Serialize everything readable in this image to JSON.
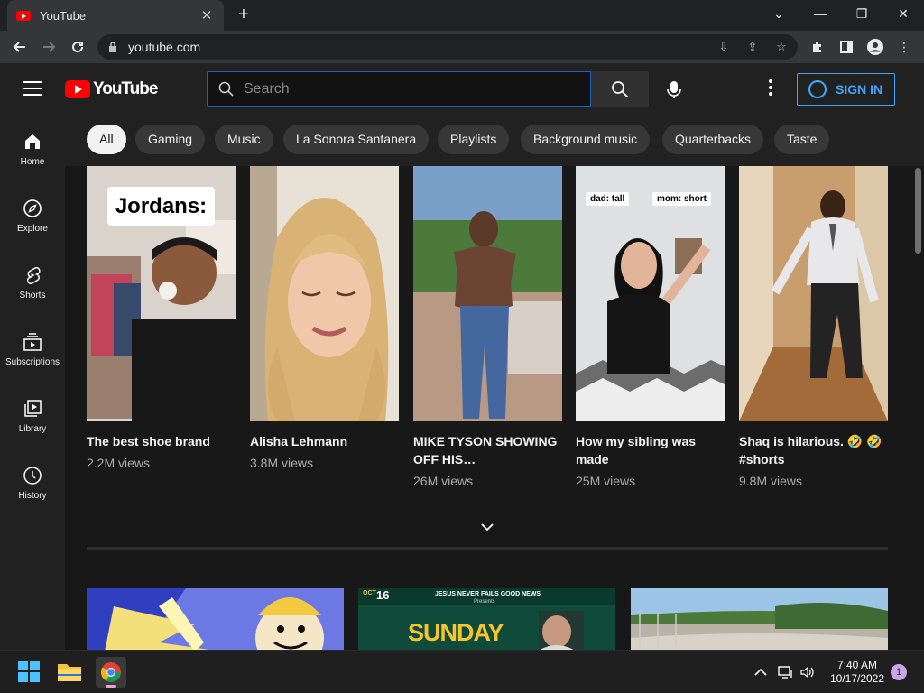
{
  "browser": {
    "tab_title": "YouTube",
    "tab_close": "✕",
    "new_tab": "+",
    "url": "youtube.com",
    "window_controls": [
      "⌄",
      "—",
      "❐",
      "✕"
    ]
  },
  "header": {
    "logo_text": "YouTube",
    "search_placeholder": "Search",
    "sign_in": "SIGN IN"
  },
  "chips": [
    "All",
    "Gaming",
    "Music",
    "La Sonora Santanera",
    "Playlists",
    "Background music",
    "Quarterbacks",
    "Taste"
  ],
  "sidebar": {
    "items": [
      {
        "label": "Home",
        "icon": "home-icon"
      },
      {
        "label": "Explore",
        "icon": "compass-icon"
      },
      {
        "label": "Shorts",
        "icon": "shorts-icon"
      },
      {
        "label": "Subscriptions",
        "icon": "subscriptions-icon"
      },
      {
        "label": "Library",
        "icon": "library-icon"
      },
      {
        "label": "History",
        "icon": "history-icon"
      }
    ]
  },
  "shorts": [
    {
      "title": "The best shoe brand",
      "views": "2.2M views",
      "overlay": "Jordans:"
    },
    {
      "title": "Alisha Lehmann",
      "views": "3.8M views"
    },
    {
      "title": "MIKE TYSON SHOWING OFF HIS…",
      "views": "26M views"
    },
    {
      "title": "How my sibling was made",
      "views": "25M views",
      "overlay_left": "dad: tall",
      "overlay_right": "mom: short"
    },
    {
      "title": "Shaq is hilarious. 🤣 🤣 #shorts",
      "views": "9.8M views"
    }
  ],
  "bottom_videos": [
    {
      "overlay": ""
    },
    {
      "date_day": "16",
      "date_month": "OCT",
      "banner": "JESUS NEVER FAILS GOOD NEWS",
      "sub": "Presents",
      "title": "SUNDAY"
    },
    {
      "overlay": ""
    }
  ],
  "taskbar": {
    "time": "7:40 AM",
    "date": "10/17/2022",
    "notifications": "1"
  },
  "colors": {
    "brand_red": "#ff0000",
    "accent_blue": "#3ea6ff",
    "background": "#0f0f0f"
  }
}
